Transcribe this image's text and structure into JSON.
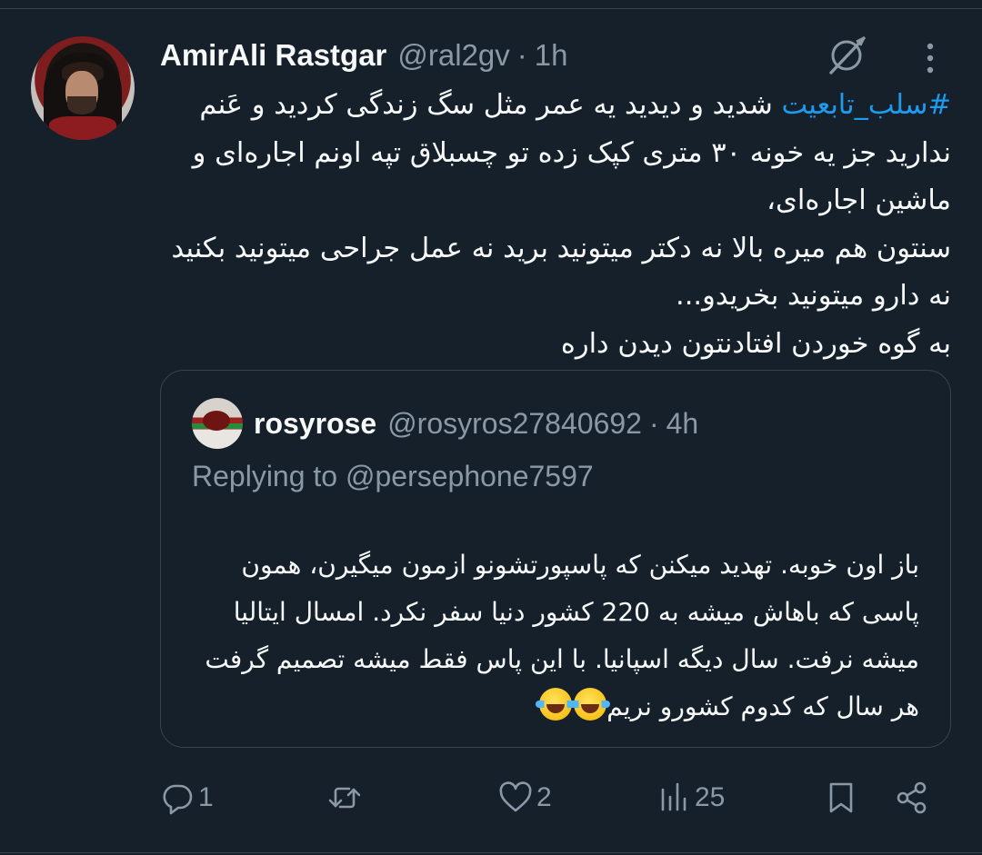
{
  "tweet": {
    "display_name": "AmirAli Rastgar",
    "handle": "@ral2gv",
    "separator": "·",
    "time": "1h",
    "hashtag": "#سلب_تابعیت",
    "text_after_hashtag": " شدید و دیدید یه عمر مثل سگ زندگی کردید و عَنم ندارید جز یه خونه ۳۰ متری کپک زده تو چسبلاق تپه اونم اجاره‌ای و ماشین اجاره‌ای،",
    "line2": "سنتون هم میره بالا نه دکتر میتونید برید نه عمل جراحی میتونید بکنید نه دارو میتونید بخریدو...",
    "line3": "به گوه خوردن افتادنتون دیدن داره"
  },
  "quoted": {
    "display_name": "rosyrose",
    "handle": "@rosyros27840692",
    "separator": "·",
    "time": "4h",
    "replying_prefix": "Replying to ",
    "replying_to": "@persephone7597",
    "text": "باز اون خوبه. تهدید میکنن که پاسپورتشونو ازمون میگیرن، همون پاسی که باهاش میشه به 220 کشور دنیا سفر نکرد. امسال ایتالیا میشه نرفت. سال دیگه اسپانیا. با این پاس فقط میشه تصمیم گرفت هر سال که کدوم کشورو نریم",
    "emoji": "face-with-tears-of-joy x2"
  },
  "actions": {
    "replies": "1",
    "likes": "2",
    "views": "25"
  },
  "icons": [
    "grok-icon",
    "more-icon",
    "reply-icon",
    "retweet-icon",
    "like-icon",
    "views-icon",
    "bookmark-icon",
    "share-icon"
  ],
  "colors": {
    "background": "#15202b",
    "text": "#f7f9f9",
    "secondary": "#8b98a5",
    "link": "#1d9bf0",
    "border": "#38444d"
  }
}
